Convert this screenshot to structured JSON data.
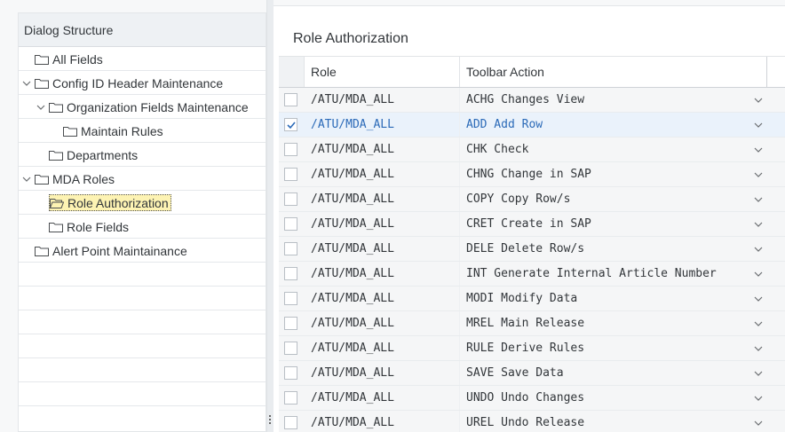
{
  "dialog_structure": {
    "title": "Dialog Structure",
    "items": [
      {
        "label": "All Fields",
        "level": 0,
        "expanded": null,
        "selected": false
      },
      {
        "label": "Config ID Header Maintenance",
        "level": 0,
        "expanded": true,
        "selected": false
      },
      {
        "label": "Organization Fields Maintenance",
        "level": 1,
        "expanded": true,
        "selected": false
      },
      {
        "label": "Maintain Rules",
        "level": 2,
        "expanded": null,
        "selected": false
      },
      {
        "label": "Departments",
        "level": 1,
        "expanded": null,
        "selected": false
      },
      {
        "label": "MDA Roles",
        "level": 0,
        "expanded": true,
        "selected": false
      },
      {
        "label": "Role Authorization",
        "level": 1,
        "expanded": null,
        "selected": true
      },
      {
        "label": "Role Fields",
        "level": 1,
        "expanded": null,
        "selected": false
      },
      {
        "label": "Alert Point Maintainance",
        "level": 0,
        "expanded": null,
        "selected": false
      }
    ]
  },
  "role_authorization": {
    "title": "Role Authorization",
    "columns": {
      "role": "Role",
      "toolbar_action": "Toolbar Action"
    },
    "rows": [
      {
        "role": "/ATU/MDA_ALL",
        "action": "ACHG Changes View",
        "selected": false
      },
      {
        "role": "/ATU/MDA_ALL",
        "action": "ADD Add Row",
        "selected": true
      },
      {
        "role": "/ATU/MDA_ALL",
        "action": "CHK Check",
        "selected": false
      },
      {
        "role": "/ATU/MDA_ALL",
        "action": "CHNG Change in SAP",
        "selected": false
      },
      {
        "role": "/ATU/MDA_ALL",
        "action": "COPY Copy Row/s",
        "selected": false
      },
      {
        "role": "/ATU/MDA_ALL",
        "action": "CRET Create in SAP",
        "selected": false
      },
      {
        "role": "/ATU/MDA_ALL",
        "action": "DELE Delete Row/s",
        "selected": false
      },
      {
        "role": "/ATU/MDA_ALL",
        "action": "INT Generate Internal Article Number",
        "selected": false
      },
      {
        "role": "/ATU/MDA_ALL",
        "action": "MODI Modify Data",
        "selected": false
      },
      {
        "role": "/ATU/MDA_ALL",
        "action": "MREL Main Release",
        "selected": false
      },
      {
        "role": "/ATU/MDA_ALL",
        "action": "RULE Derive Rules",
        "selected": false
      },
      {
        "role": "/ATU/MDA_ALL",
        "action": "SAVE Save Data",
        "selected": false
      },
      {
        "role": "/ATU/MDA_ALL",
        "action": "UNDO Undo Changes",
        "selected": false
      },
      {
        "role": "/ATU/MDA_ALL",
        "action": "UREL Undo Release",
        "selected": false
      }
    ]
  },
  "colors": {
    "selected_tree_bg": "#fdf3b3",
    "selected_row_bg": "#eaf2fb",
    "selected_row_text": "#2b6ab8",
    "check_color": "#2b6ab8"
  },
  "icons": {
    "tree_folder": "folder-icon",
    "tree_caret": "chevron-down-icon",
    "dropdown": "chevron-down-icon",
    "checkbox": "checkmark-icon"
  }
}
